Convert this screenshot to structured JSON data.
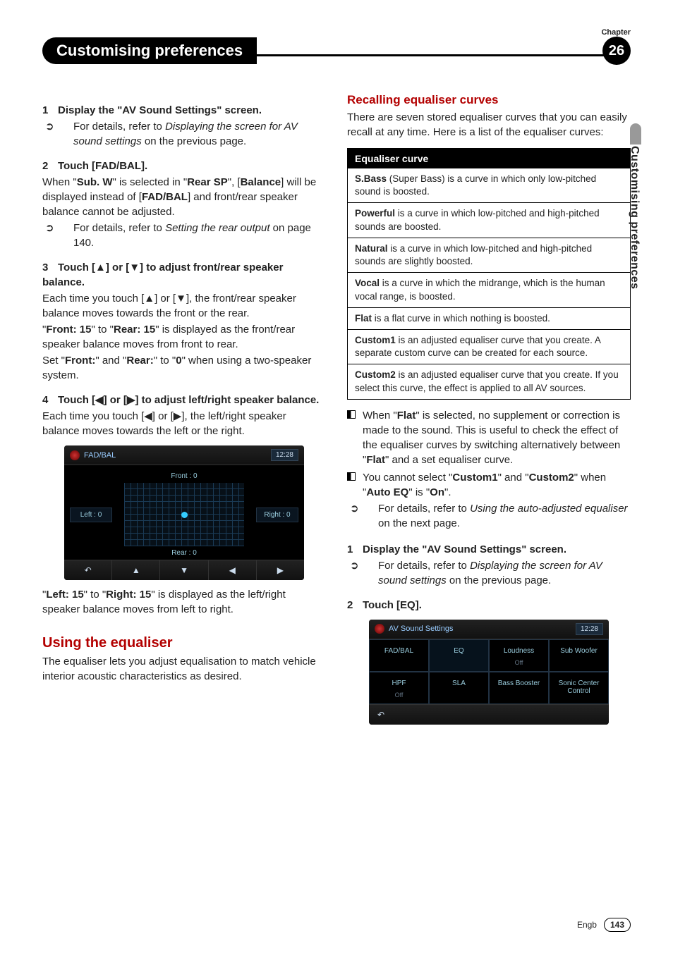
{
  "meta": {
    "chapter_label": "Chapter",
    "chapter_number": "26",
    "title": "Customising preferences",
    "side_tab": "Customising preferences",
    "footer_lang": "Engb",
    "page_number": "143"
  },
  "left": {
    "step1": {
      "head_num": "1",
      "head_text": "Display the \"AV Sound Settings\" screen.",
      "ref_arrow": "➲",
      "ref_prefix": "For details, refer to ",
      "ref_ital": "Displaying the screen for AV sound settings",
      "ref_suffix": " on the previous page."
    },
    "step2": {
      "head_num": "2",
      "head_text": "Touch [FAD/BAL].",
      "p1_a": "When \"",
      "p1_subw": "Sub. W",
      "p1_b": "\" is selected in \"",
      "p1_rearsp": "Rear SP",
      "p1_c": "\", [",
      "p1_balance": "Balance",
      "p1_d": "] will be displayed instead of [",
      "p1_fadbal": "FAD/BAL",
      "p1_e": "] and front/rear speaker balance cannot be adjusted.",
      "ref_arrow": "➲",
      "ref_prefix": "For details, refer to ",
      "ref_ital": "Setting the rear output",
      "ref_suffix": " on page 140."
    },
    "step3": {
      "head_num": "3",
      "head_text": "Touch [▲] or [▼] to adjust front/rear speaker balance.",
      "p1": "Each time you touch [▲] or [▼], the front/rear speaker balance moves towards the front or the rear.",
      "p2_a": "\"",
      "p2_front": "Front: 15",
      "p2_b": "\" to \"",
      "p2_rear": "Rear: 15",
      "p2_c": "\" is displayed as the front/rear speaker balance moves from front to rear.",
      "p3_a": "Set \"",
      "p3_front": "Front:",
      "p3_b": "\" and \"",
      "p3_rear": "Rear:",
      "p3_c": "\" to \"",
      "p3_zero": "0",
      "p3_d": "\" when using a two-speaker system."
    },
    "step4": {
      "head_num": "4",
      "head_text": "Touch [◀] or [▶] to adjust left/right speaker balance.",
      "p1": "Each time you touch [◀] or [▶], the left/right speaker balance moves towards the left or the right."
    },
    "fad_shot": {
      "title": "FAD/BAL",
      "clock": "12:28",
      "front": "Front :  0",
      "left": "Left :  0",
      "right": "Right :  0",
      "rear": "Rear :  0",
      "btn_back": "↶",
      "btn_up": "▲",
      "btn_down": "▼",
      "btn_left": "◀",
      "btn_right": "▶"
    },
    "after_shot_a": "\"",
    "after_shot_left": "Left: 15",
    "after_shot_b": "\" to \"",
    "after_shot_right": "Right: 15",
    "after_shot_c": "\" is displayed as the left/right speaker balance moves from left to right.",
    "eq_heading": "Using the equaliser",
    "eq_para": "The equaliser lets you adjust equalisation to match vehicle interior acoustic characteristics as desired."
  },
  "right": {
    "recall_heading": "Recalling equaliser curves",
    "recall_intro": "There are seven stored equaliser curves that you can easily recall at any time. Here is a list of the equaliser curves:",
    "table_header": "Equaliser curve",
    "curves": [
      {
        "name": "S.Bass",
        "desc": " (Super Bass) is a curve in which only low-pitched sound is boosted."
      },
      {
        "name": "Powerful",
        "desc": " is a curve in which low-pitched and high-pitched sounds are boosted."
      },
      {
        "name": "Natural",
        "desc": " is a curve in which low-pitched and high-pitched sounds are slightly boosted."
      },
      {
        "name": "Vocal",
        "desc": " is a curve in which the midrange, which is the human vocal range, is boosted."
      },
      {
        "name": "Flat",
        "desc": " is a flat curve in which nothing is boosted."
      },
      {
        "name": "Custom1",
        "desc": " is an adjusted equaliser curve that you create. A separate custom curve can be created for each source."
      },
      {
        "name": "Custom2",
        "desc": " is an adjusted equaliser curve that you create. If you select this curve, the effect is applied to all AV sources."
      }
    ],
    "note1_a": "When \"",
    "note1_flat": "Flat",
    "note1_b": "\" is selected, no supplement or correction is made to the sound. This is useful to check the effect of the equaliser curves by switching alternatively between \"",
    "note1_c": "\" and a set equaliser curve.",
    "note2_a": "You cannot select \"",
    "note2_c1": "Custom1",
    "note2_b": "\" and \"",
    "note2_c2": "Custom2",
    "note2_c": "\" when \"",
    "note2_auto": "Auto EQ",
    "note2_d": "\" is \"",
    "note2_on": "On",
    "note2_e": "\".",
    "note2_ref_arrow": "➲",
    "note2_ref_prefix": "For details, refer to ",
    "note2_ref_ital": "Using the auto-adjusted equaliser",
    "note2_ref_suffix": " on the next page.",
    "step1": {
      "head_num": "1",
      "head_text": "Display the \"AV Sound Settings\" screen.",
      "ref_arrow": "➲",
      "ref_prefix": "For details, refer to ",
      "ref_ital": "Displaying the screen for AV sound settings",
      "ref_suffix": " on the previous page."
    },
    "step2": {
      "head_num": "2",
      "head_text": "Touch [EQ]."
    },
    "av_shot": {
      "title": "AV Sound Settings",
      "clock": "12:28",
      "cells": [
        {
          "t": "FAD/BAL",
          "s": ""
        },
        {
          "t": "EQ",
          "s": ""
        },
        {
          "t": "Loudness",
          "s": "Off"
        },
        {
          "t": "Sub Woofer",
          "s": ""
        },
        {
          "t": "HPF",
          "s": "Off"
        },
        {
          "t": "SLA",
          "s": ""
        },
        {
          "t": "Bass Booster",
          "s": ""
        },
        {
          "t": "Sonic Center Control",
          "s": ""
        }
      ],
      "back": "↶"
    }
  }
}
